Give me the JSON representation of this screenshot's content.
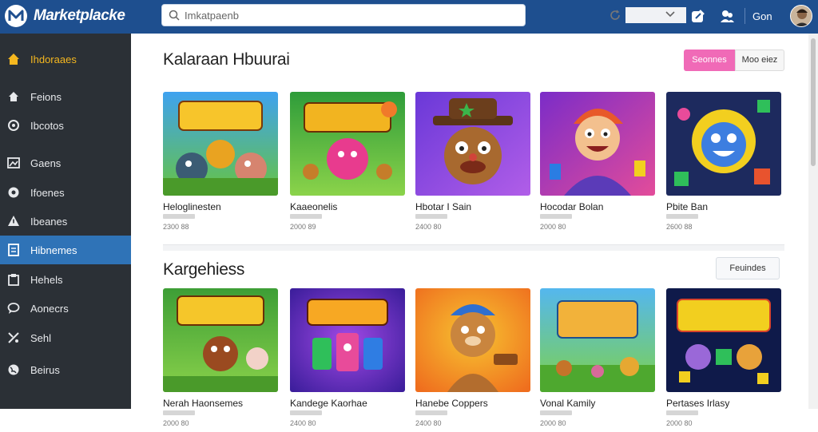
{
  "app": {
    "brand": "Marketplacke",
    "user_name": "Gon"
  },
  "search": {
    "placeholder": "Imkatpaenb"
  },
  "sidebar": {
    "items": [
      {
        "label": "Ihdoraaes",
        "icon": "home-icon"
      },
      {
        "label": "Feions",
        "icon": "home-icon"
      },
      {
        "label": "Ibcotos",
        "icon": "circle-info-icon"
      },
      {
        "label": "Gaens",
        "icon": "image-icon"
      },
      {
        "label": "Ifoenes",
        "icon": "settings-circle-icon"
      },
      {
        "label": "Ibeanes",
        "icon": "warning-icon"
      },
      {
        "label": "Hibnemes",
        "icon": "document-icon"
      },
      {
        "label": "Hehels",
        "icon": "clipboard-icon"
      },
      {
        "label": "Aonecrs",
        "icon": "chat-icon"
      },
      {
        "label": "Sehl",
        "icon": "tools-icon"
      },
      {
        "label": "Beirus",
        "icon": "globe-icon"
      }
    ],
    "active_index": 6
  },
  "section1": {
    "title": "Kalaraan Hbuurai",
    "btn_primary": "Seonnes",
    "btn_secondary": "Moo eiez",
    "cards": [
      {
        "name": "Heloglinesten",
        "meta": "2300 88",
        "colors": [
          "#3fa2f0",
          "#67c440"
        ]
      },
      {
        "name": "Kaaeonelis",
        "meta": "2000 89",
        "colors": [
          "#2e9c3a",
          "#8bd34a"
        ]
      },
      {
        "name": "Hbotar I Sain",
        "meta": "2400 80",
        "colors": [
          "#6a38d8",
          "#b15ee8"
        ]
      },
      {
        "name": "Hocodar Bolan",
        "meta": "2000 80",
        "colors": [
          "#7b2cc8",
          "#e34c9a"
        ]
      },
      {
        "name": "Pbite Ban",
        "meta": "2600 88",
        "colors": [
          "#f2cf1f",
          "#2b7de3"
        ]
      }
    ]
  },
  "section2": {
    "title": "Kargehiess",
    "btn_feature": "Feuindes",
    "cards": [
      {
        "name": "Nerah Haonsemes",
        "meta": "2000 80",
        "colors": [
          "#3d9e36",
          "#89d14a"
        ]
      },
      {
        "name": "Kandege Kaorhae",
        "meta": "2400 80",
        "colors": [
          "#5a2fc6",
          "#a149e6"
        ]
      },
      {
        "name": "Hanebe Coppers",
        "meta": "2400 80",
        "colors": [
          "#ef8a1e",
          "#f7c431"
        ]
      },
      {
        "name": "Vonal Kamily",
        "meta": "2000 80",
        "colors": [
          "#54b7ef",
          "#7fd24a"
        ]
      },
      {
        "name": "Pertases Irlasy",
        "meta": "2000 80",
        "colors": [
          "#0f1a4a",
          "#2a3f9e"
        ]
      }
    ]
  },
  "colors": {
    "topbar": "#1e4f8f",
    "sidebar": "#2b3036",
    "sidebar_active": "#2f73b7",
    "accent_pink": "#f06ab7",
    "sidebar_first_label": "#f5b71f"
  }
}
